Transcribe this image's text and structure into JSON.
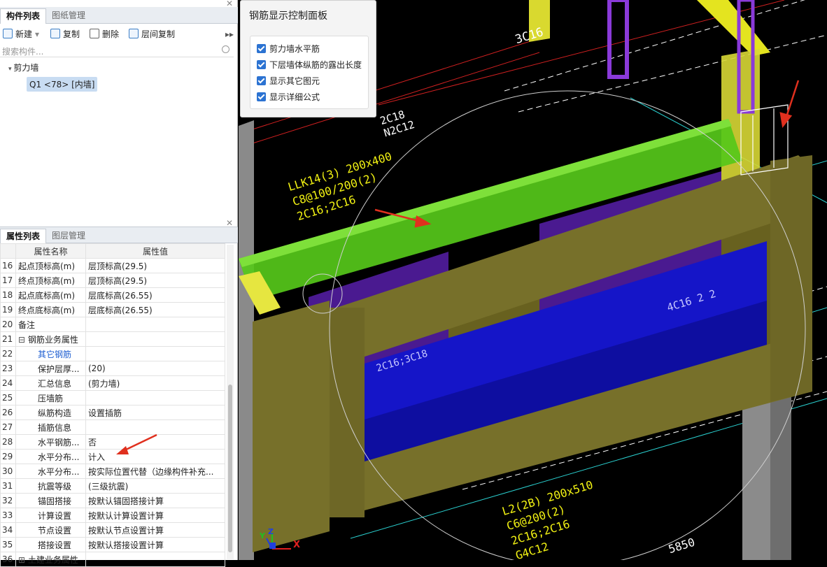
{
  "component_panel": {
    "tabs": [
      "构件列表",
      "图纸管理"
    ],
    "toolbar": {
      "new": "新建",
      "copy": "复制",
      "delete": "删除",
      "floor_copy": "层间复制"
    },
    "search_placeholder": "搜索构件...",
    "tree": {
      "group": "剪力墙",
      "item": "Q1 <78> [内墙]"
    }
  },
  "property_panel": {
    "tabs": [
      "属性列表",
      "图层管理"
    ],
    "headers": [
      "属性名称",
      "属性值"
    ],
    "rows": [
      {
        "n": "16",
        "name": "起点顶标高(m)",
        "value": "层顶标高(29.5)"
      },
      {
        "n": "17",
        "name": "终点顶标高(m)",
        "value": "层顶标高(29.5)"
      },
      {
        "n": "18",
        "name": "起点底标高(m)",
        "value": "层底标高(26.55)"
      },
      {
        "n": "19",
        "name": "终点底标高(m)",
        "value": "层底标高(26.55)"
      },
      {
        "n": "20",
        "name": "备注",
        "value": ""
      },
      {
        "n": "21",
        "name": "钢筋业务属性",
        "value": ""
      },
      {
        "n": "22",
        "name": "其它钢筋",
        "value": ""
      },
      {
        "n": "23",
        "name": "保护层厚...",
        "value": "(20)"
      },
      {
        "n": "24",
        "name": "汇总信息",
        "value": "(剪力墙)"
      },
      {
        "n": "25",
        "name": "压墙筋",
        "value": ""
      },
      {
        "n": "26",
        "name": "纵筋构造",
        "value": "设置插筋"
      },
      {
        "n": "27",
        "name": "插筋信息",
        "value": ""
      },
      {
        "n": "28",
        "name": "水平钢筋...",
        "value": "否"
      },
      {
        "n": "29",
        "name": "水平分布...",
        "value": "计入"
      },
      {
        "n": "30",
        "name": "水平分布...",
        "value": "按实际位置代替（边缘构件补充..."
      },
      {
        "n": "31",
        "name": "抗震等级",
        "value": "(三级抗震)"
      },
      {
        "n": "32",
        "name": "锚固搭接",
        "value": "按默认锚固搭接计算"
      },
      {
        "n": "33",
        "name": "计算设置",
        "value": "按默认计算设置计算"
      },
      {
        "n": "34",
        "name": "节点设置",
        "value": "按默认节点设置计算"
      },
      {
        "n": "35",
        "name": "搭接设置",
        "value": "按默认搭接设置计算"
      },
      {
        "n": "36",
        "name": "土建业务属性",
        "value": ""
      }
    ]
  },
  "rebar_panel": {
    "title": "钢筋显示控制面板",
    "options": [
      "剪力墙水平筋",
      "下层墙体纵筋的露出长度",
      "显示其它图元",
      "显示详细公式"
    ]
  },
  "cad_labels": {
    "a": "3C16",
    "b1": "2C18",
    "b2": "N2C12",
    "c1": "LLK14(3) 200x400",
    "c2": "C8@100/200(2)",
    "c3": "2C16;2C16",
    "d": "4C16 2 2",
    "e": "2C16;3C18",
    "f1": "L2(2B) 200x510",
    "f2": "C6@200(2)",
    "f3": "2C16;2C16",
    "f4": "G4C12",
    "g": "5850",
    "axis_x": "X",
    "axis_y": "Y",
    "axis_z": "Z"
  },
  "colors": {
    "accent": "#2c73d2",
    "beam": "#5ad015",
    "wall": "#77702a",
    "opening": "#1a1ad9",
    "annotation": "#f2f213"
  }
}
